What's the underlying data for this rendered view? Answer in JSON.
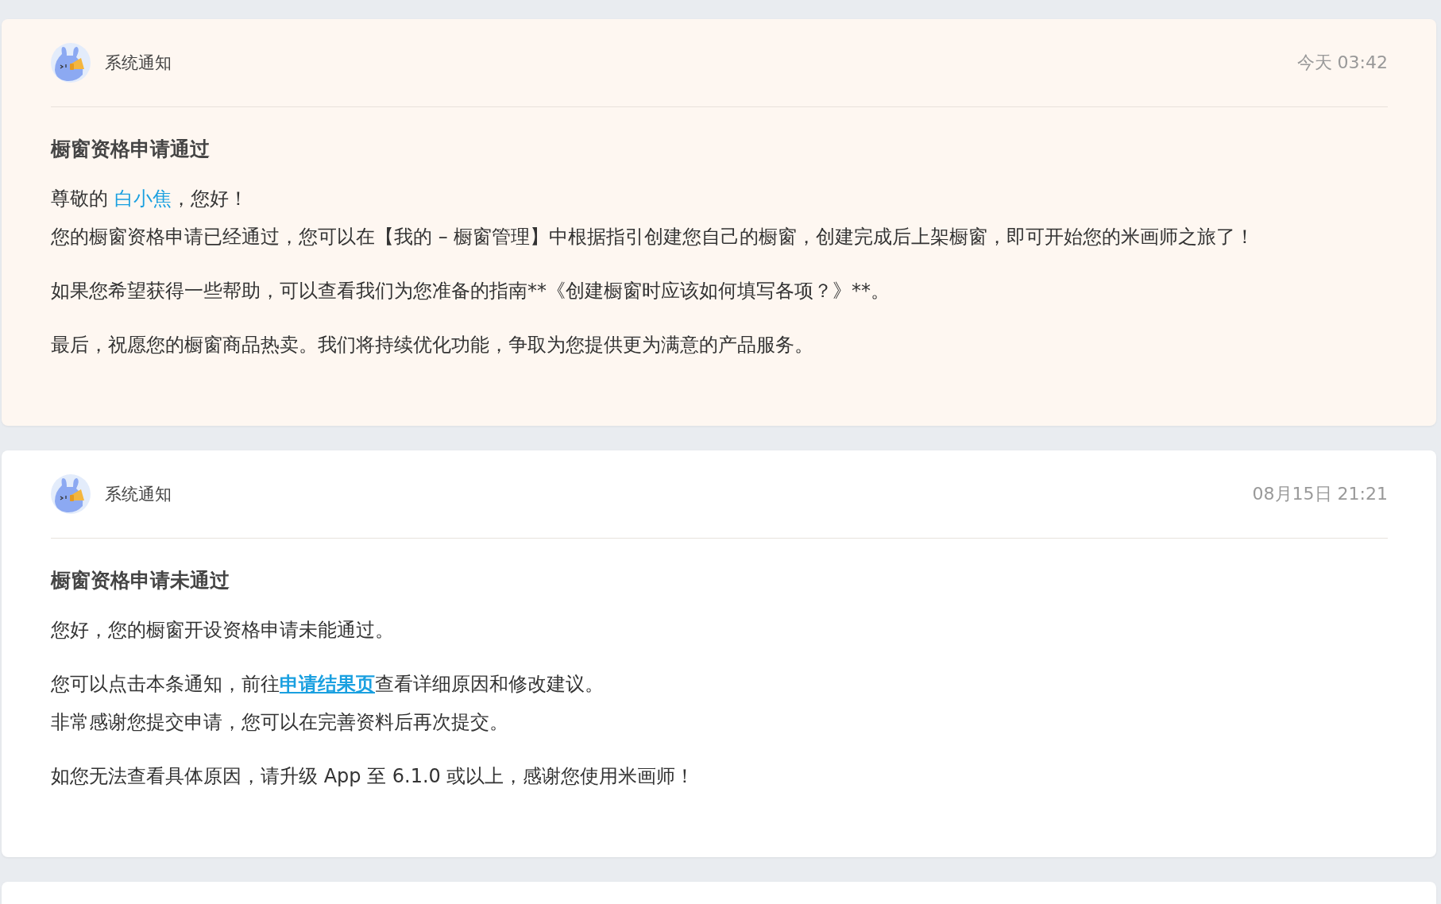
{
  "notifications": [
    {
      "read": false,
      "sender": "系统通知",
      "time": "今天 03:42",
      "title": "橱窗资格申请通过",
      "paragraphs": [
        [
          {
            "kind": "text",
            "text": "尊敬的 "
          },
          {
            "kind": "name",
            "text": "白小焦"
          },
          {
            "kind": "text",
            "text": "，您好！"
          },
          {
            "kind": "break"
          },
          {
            "kind": "text",
            "text": "您的橱窗资格申请已经通过，您可以在【我的 – 橱窗管理】中根据指引创建您自己的橱窗，创建完成后上架橱窗，即可开始您的米画师之旅了！"
          }
        ],
        [
          {
            "kind": "text",
            "text": "如果您希望获得一些帮助，可以查看我们为您准备的指南**《创建橱窗时应该如何填写各项？》**。"
          }
        ],
        [
          {
            "kind": "text",
            "text": "最后，祝愿您的橱窗商品热卖。我们将持续优化功能，争取为您提供更为满意的产品服务。"
          }
        ]
      ]
    },
    {
      "read": true,
      "sender": "系统通知",
      "time": "08月15日 21:21",
      "title": "橱窗资格申请未通过",
      "paragraphs": [
        [
          {
            "kind": "text",
            "text": "您好，您的橱窗开设资格申请未能通过。"
          }
        ],
        [
          {
            "kind": "text",
            "text": "您可以点击本条通知，前往"
          },
          {
            "kind": "link",
            "text": "申请结果页"
          },
          {
            "kind": "text",
            "text": "查看详细原因和修改建议。"
          },
          {
            "kind": "break"
          },
          {
            "kind": "text",
            "text": "非常感谢您提交申请，您可以在完善资料后再次提交。"
          }
        ],
        [
          {
            "kind": "text",
            "text": "如您无法查看具体原因，请升级 App 至 6.1.0 或以上，感谢您使用米画师！"
          }
        ]
      ]
    },
    {
      "kind": "partial"
    }
  ]
}
